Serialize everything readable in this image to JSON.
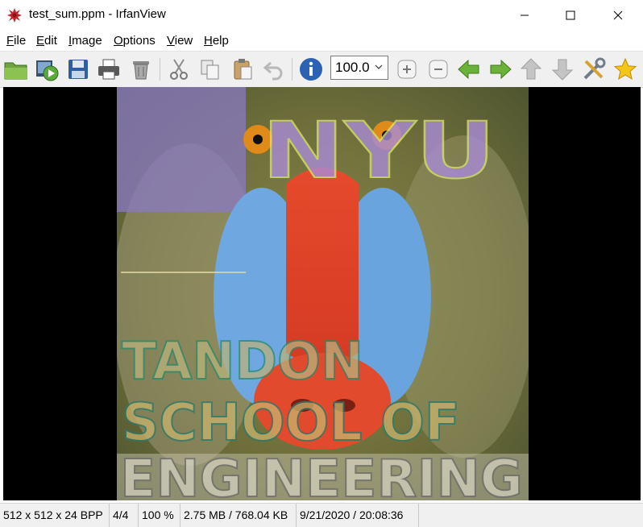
{
  "window": {
    "title": "test_sum.ppm - IrfanView",
    "minimize_icon": "minimize-icon",
    "maximize_icon": "maximize-icon",
    "close_icon": "close-icon"
  },
  "menu": [
    {
      "key": "F",
      "rest": "ile"
    },
    {
      "key": "E",
      "rest": "dit"
    },
    {
      "key": "I",
      "rest": "mage"
    },
    {
      "key": "O",
      "rest": "ptions"
    },
    {
      "key": "V",
      "rest": "iew"
    },
    {
      "key": "H",
      "rest": "elp"
    }
  ],
  "toolbar": {
    "buttons": [
      "open-folder-icon",
      "slideshow-icon",
      "save-icon",
      "print-icon",
      "delete-icon",
      "cut-icon",
      "copy-icon",
      "paste-icon",
      "undo-icon",
      "info-icon",
      "zoom-in-icon",
      "zoom-out-icon",
      "previous-icon",
      "next-icon",
      "move-up-icon",
      "move-down-icon",
      "settings-icon",
      "favorite-icon"
    ],
    "zoom_value": "100.0"
  },
  "image": {
    "description_colors": {
      "background": "#000000",
      "fur": "#7a7a3a",
      "nose": "#e2452b",
      "cheeks": "#5fa6e6"
    },
    "overlay_text": [
      "NYU",
      "TANDON",
      "SCHOOL OF",
      "ENGINEERING"
    ]
  },
  "status": {
    "dimensions": "512 x 512 x 24 BPP",
    "index": "4/4",
    "zoom": "100 %",
    "size": "2.75 MB / 768.04 KB",
    "datetime": "9/21/2020 / 20:08:36"
  }
}
